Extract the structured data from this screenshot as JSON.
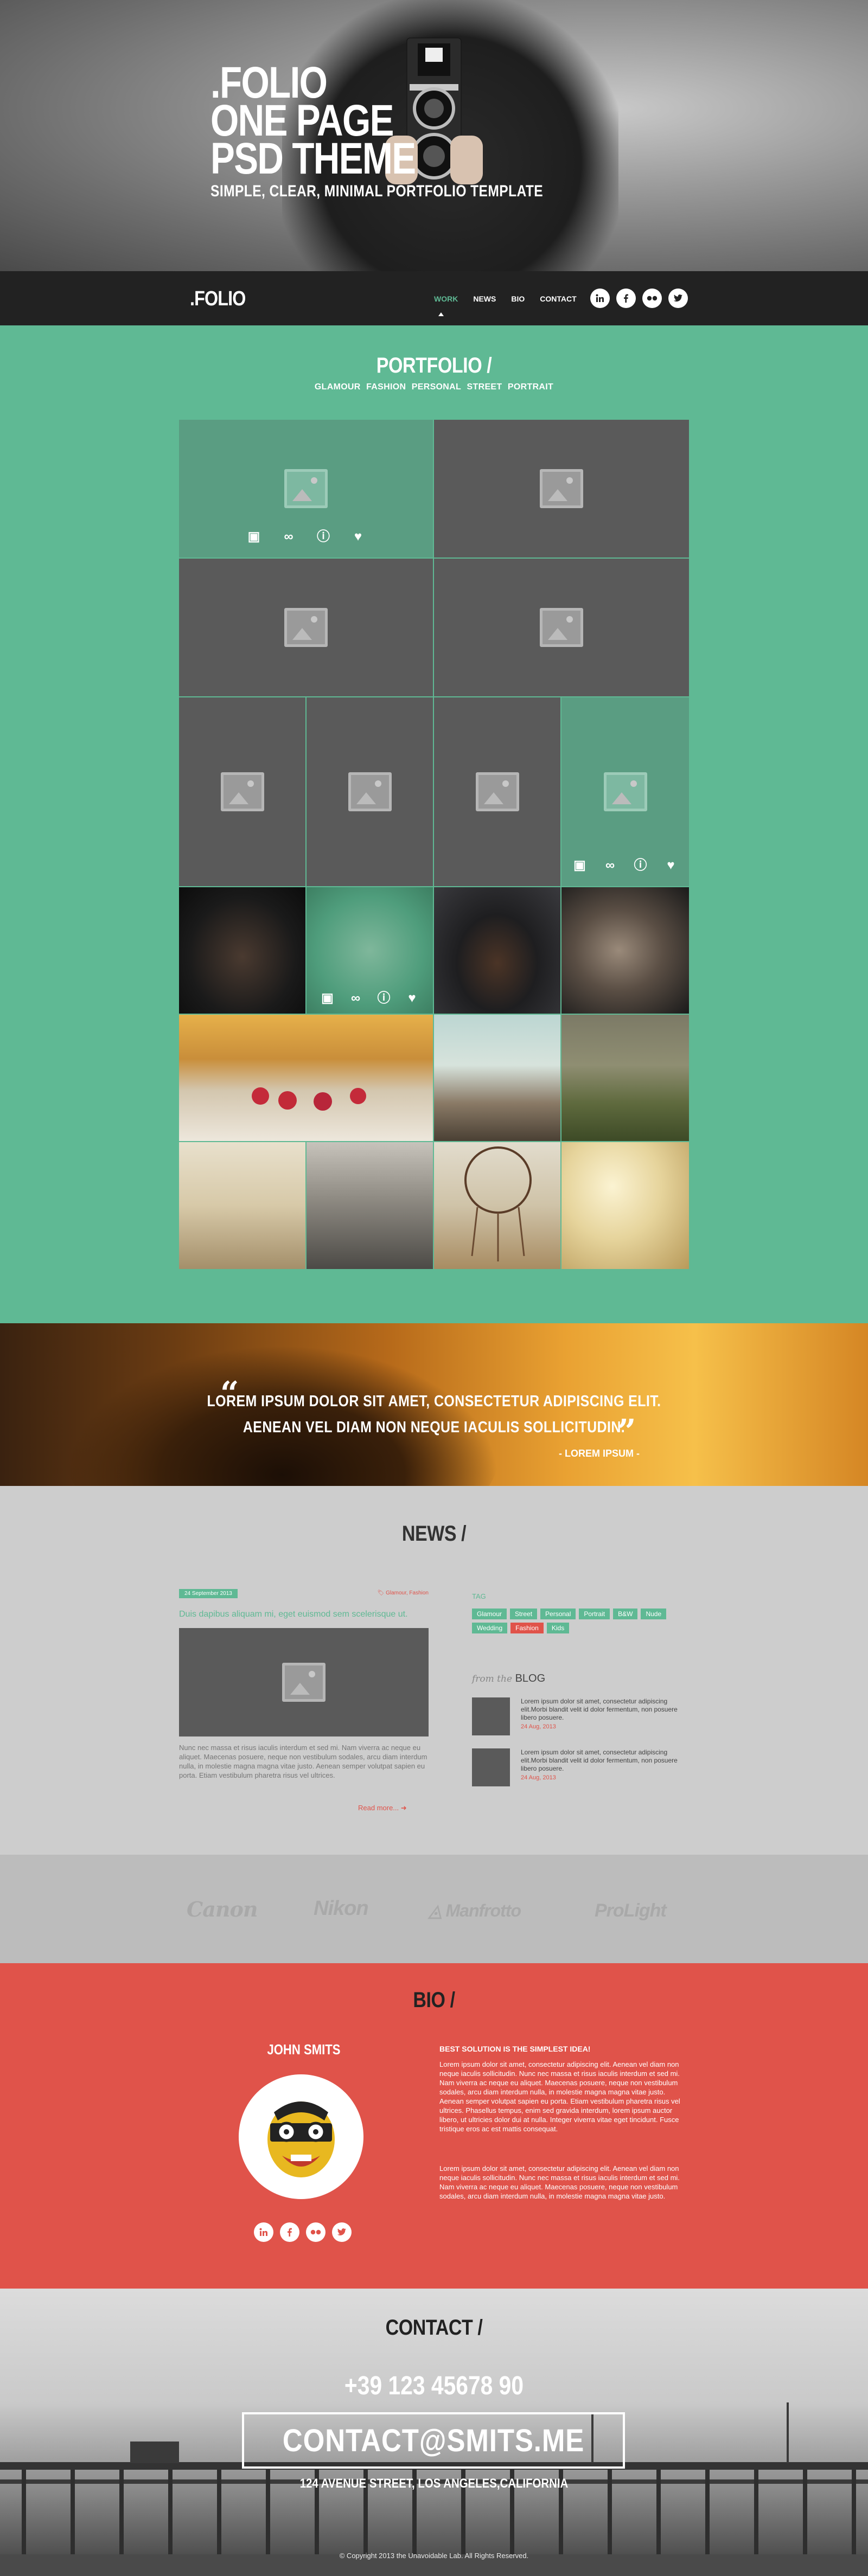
{
  "hero": {
    "line1": ".FOLIO",
    "line2": "ONE PAGE",
    "line3": "PSD THEME",
    "subtitle": "SIMPLE, CLEAR, MINIMAL PORTFOLIO TEMPLATE"
  },
  "nav": {
    "logo": ".FOLIO",
    "items": [
      "WORK",
      "NEWS",
      "BIO",
      "CONTACT"
    ],
    "social": [
      "linkedin-icon",
      "facebook-icon",
      "flickr-icon",
      "twitter-icon"
    ]
  },
  "portfolio": {
    "title": "PORTFOLIO /",
    "filters": [
      "GLAMOUR",
      "FASHION",
      "PERSONAL",
      "STREET",
      "PORTRAIT"
    ]
  },
  "quote": {
    "line1": "LOREM IPSUM DOLOR SIT AMET, CONSECTETUR ADIPISCING ELIT.",
    "line2": "AENEAN VEL DIAM NON NEQUE IACULIS SOLLICITUDIN.",
    "author": "- LOREM IPSUM -"
  },
  "news": {
    "title": "NEWS /",
    "post": {
      "date": "24 September 2013",
      "categories": "Glamour, Fashion",
      "title": "Duis dapibus aliquam mi, eget euismod sem scelerisque ut.",
      "body": "Nunc nec massa et risus iaculis interdum et sed mi. Nam viverra ac neque eu aliquet. Maecenas posuere, neque non vestibulum sodales, arcu diam interdum nulla, in molestie magna magna vitae justo. Aenean semper volutpat sapien eu porta. Etiam vestibulum pharetra risus vel ultrices.",
      "read_more": "Read more..."
    },
    "tags_label": "TAG",
    "tags": [
      "Glamour",
      "Street",
      "Personal",
      "Portrait",
      "B&W",
      "Nude",
      "Wedding",
      "Fashion",
      "Kids"
    ],
    "blog_prefix": "from the",
    "blog_title": "BLOG",
    "blog_items": [
      {
        "text": "Lorem ipsum dolor sit amet, consectetur adipiscing elit.Morbi blandit velit id dolor fermentum, non posuere libero posuere.",
        "date": "24 Aug, 2013"
      },
      {
        "text": "Lorem ipsum dolor sit amet, consectetur adipiscing elit.Morbi blandit velit id dolor fermentum, non posuere libero posuere.",
        "date": "24 Aug, 2013"
      }
    ]
  },
  "brands": [
    "Canon",
    "Nikon",
    "Manfrotto",
    "ProLight"
  ],
  "bio": {
    "title": "BIO /",
    "name": "JOHN SMITS",
    "heading": "BEST SOLUTION IS THE SIMPLEST IDEA!",
    "para1": "Lorem ipsum dolor sit amet, consectetur adipiscing elit. Aenean vel diam non neque iaculis sollicitudin. Nunc nec massa et risus iaculis interdum et sed mi. Nam viverra ac neque eu aliquet. Maecenas posuere, neque non vestibulum sodales, arcu diam interdum nulla, in molestie magna magna vitae justo. Aenean semper volutpat sapien eu porta. Etiam vestibulum pharetra risus vel ultrices. Phasellus tempus, enim sed gravida interdum, lorem ipsum auctor libero, ut ultricies dolor dui at nulla. Integer viverra vitae eget tincidunt. Fusce tristique eros ac est mattis consequat.",
    "para2": "Lorem ipsum dolor sit amet, consectetur adipiscing elit. Aenean vel diam non neque iaculis sollicitudin. Nunc nec massa et risus iaculis interdum et sed mi. Nam viverra ac neque eu aliquet. Maecenas posuere, neque non vestibulum sodales, arcu diam interdum nulla, in molestie magna magna vitae justo."
  },
  "contact": {
    "title": "CONTACT /",
    "phone": "+39 123 45678 90",
    "email": "CONTACT@SMITS.ME",
    "address": "124 AVENUE STREET, LOS ANGELES,CALIFORNIA",
    "copyright": "© Copyright 2013 the Unavoidable Lab. All Rights Reserved."
  },
  "colors": {
    "accent_green": "#5fb994",
    "accent_red": "#e0534a",
    "dark": "#222222"
  }
}
